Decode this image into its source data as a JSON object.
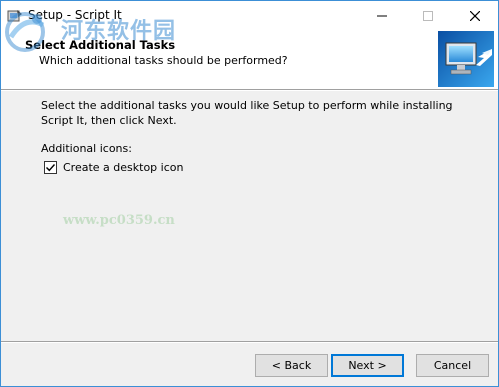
{
  "window": {
    "title": "Setup - Script It"
  },
  "header": {
    "title": "Select Additional Tasks",
    "subtitle": "Which additional tasks should be performed?"
  },
  "content": {
    "description": "Select the additional tasks you would like Setup to perform while installing Script It, then click Next.",
    "additional_icons_label": "Additional icons:",
    "desktop_icon_label": "Create a desktop icon",
    "desktop_icon_checked": true
  },
  "buttons": {
    "back": "< Back",
    "next": "Next >",
    "cancel": "Cancel"
  },
  "watermark": {
    "site_name": "河东软件园",
    "url": "www.pc0359.cn"
  },
  "colors": {
    "accent": "#0078d7",
    "window_border": "#3c8fd6",
    "dialog_bg": "#f0f0f0"
  }
}
